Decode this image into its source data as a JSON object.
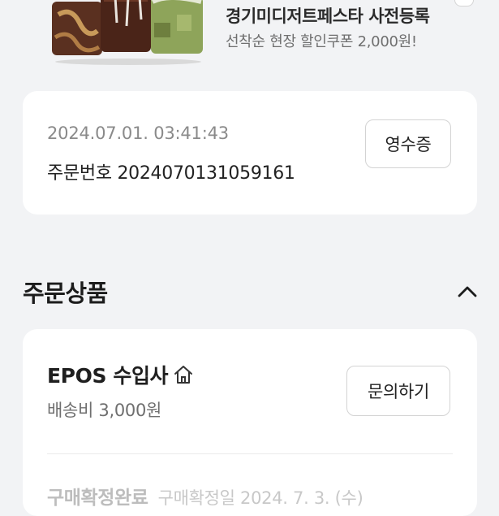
{
  "banner": {
    "title": "경기미디저트페스타 사전등록",
    "subtitle": "선착순 현장 할인쿠폰 2,000원!"
  },
  "order": {
    "datetime": "2024.07.01. 03:41:43",
    "order_number": "주문번호 2024070131059161",
    "receipt_label": "영수증"
  },
  "section": {
    "title": "주문상품"
  },
  "product": {
    "seller": "EPOS 수입사",
    "shipping": "배송비 3,000원",
    "inquiry_label": "문의하기",
    "status": "구매확정완료",
    "confirm_text": "구매확정일 2024. 7. 3. (수)"
  },
  "colors": {
    "background": "#f2f3f5",
    "card": "#ffffff",
    "muted_text": "#8a8a8a"
  },
  "icons": {
    "collapse": "chevron-up-icon",
    "seller_home": "home-icon"
  }
}
